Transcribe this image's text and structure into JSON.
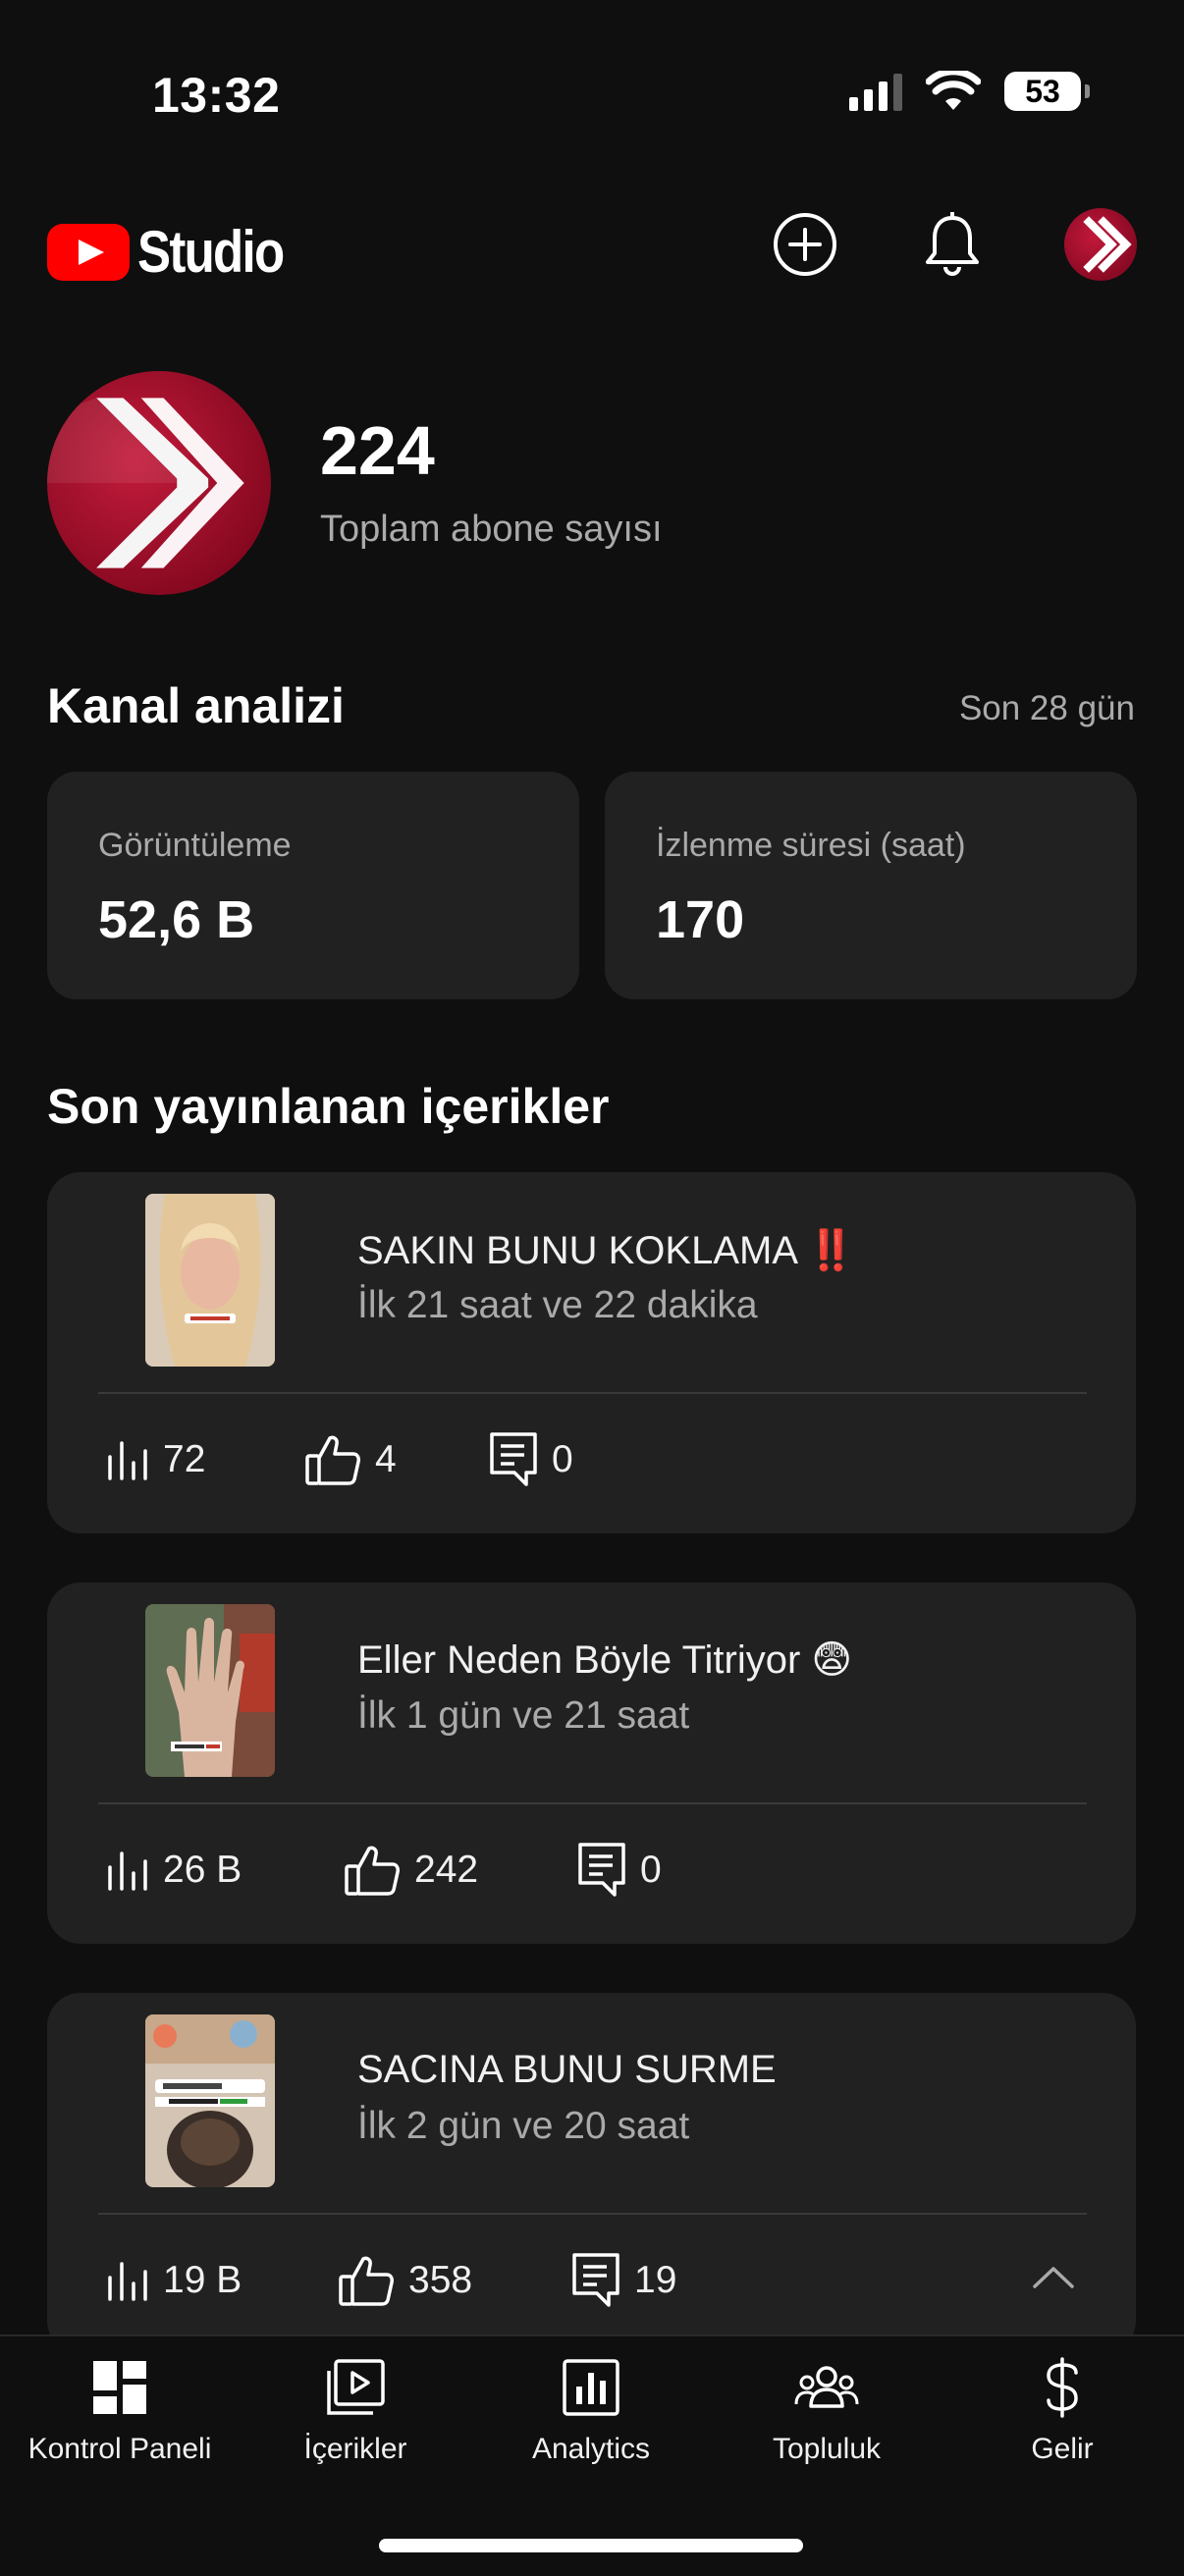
{
  "status_bar": {
    "time": "13:32",
    "battery": "53"
  },
  "header": {
    "logo_text": "Studio",
    "icons": [
      "create-icon",
      "bell-icon",
      "avatar"
    ]
  },
  "channel": {
    "subscriber_count": "224",
    "subscriber_label": "Toplam abone sayısı"
  },
  "analytics": {
    "title": "Kanal analizi",
    "period": "Son 28 gün",
    "cards": [
      {
        "label": "Görüntüleme",
        "value": "52,6 B"
      },
      {
        "label": "İzlenme süresi (saat)",
        "value": "170"
      }
    ]
  },
  "recent": {
    "title": "Son yayınlanan içerikler",
    "videos": [
      {
        "title": "SAKIN BUNU KOKLAMA ‼️",
        "subtitle": "İlk 21 saat ve 22 dakika",
        "views": "72",
        "likes": "4",
        "comments": "0"
      },
      {
        "title": "Eller Neden Böyle Titriyor 😨",
        "subtitle": "İlk 1 gün ve 21 saat",
        "views": "26 B",
        "likes": "242",
        "comments": "0"
      },
      {
        "title": "SACINA BUNU SURME",
        "subtitle": "İlk 2 gün ve 20 saat",
        "views": "19 B",
        "likes": "358",
        "comments": "19"
      }
    ]
  },
  "bottom_nav": {
    "items": [
      {
        "label": "Kontrol Paneli",
        "icon": "dashboard-icon"
      },
      {
        "label": "İçerikler",
        "icon": "content-icon"
      },
      {
        "label": "Analytics",
        "icon": "analytics-icon"
      },
      {
        "label": "Topluluk",
        "icon": "community-icon"
      },
      {
        "label": "Gelir",
        "icon": "dollar-icon"
      }
    ]
  },
  "colors": {
    "background": "#0f0f0f",
    "card": "#212121",
    "brand_red": "#ff0000",
    "avatar_red": "#a8102f",
    "secondary_text": "#aaaaaa"
  }
}
